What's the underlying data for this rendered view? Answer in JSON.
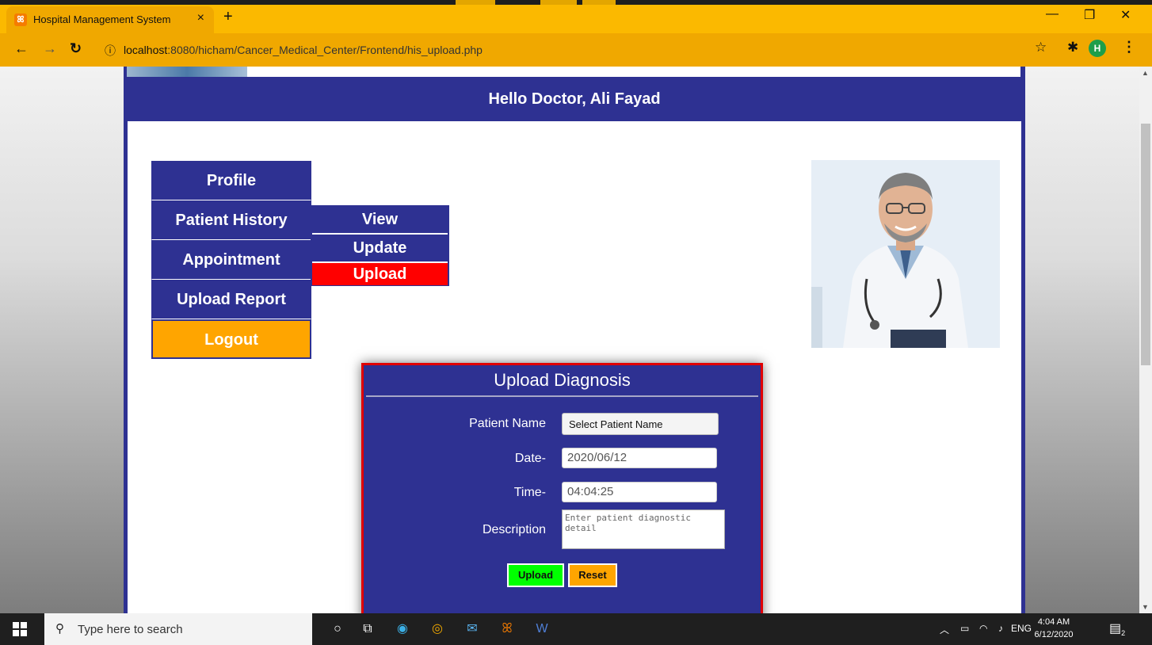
{
  "browser": {
    "tab_title": "Hospital Management System",
    "tab_close": "×",
    "new_tab": "+",
    "url_host": "localhost",
    "url_rest": ":8080/hicham/Cancer_Medical_Center/Frontend/his_upload.php",
    "profile_initial": "H",
    "window_controls": {
      "minimize": "—",
      "restore": "❐",
      "close": "✕"
    }
  },
  "page": {
    "greeting": "Hello Doctor, Ali Fayad",
    "menu": [
      {
        "label": "Profile"
      },
      {
        "label": "Patient History"
      },
      {
        "label": "Appointment"
      },
      {
        "label": "Upload Report"
      },
      {
        "label": "Logout"
      }
    ],
    "submenu": [
      {
        "label": "View"
      },
      {
        "label": "Update"
      },
      {
        "label": "Upload",
        "active": true
      }
    ],
    "form": {
      "title": "Upload Diagnosis",
      "patient_label": "Patient Name",
      "patient_value": "Select Patient Name",
      "date_label": "Date-",
      "date_value": "2020/06/12",
      "time_label": "Time-",
      "time_value": "04:04:25",
      "description_label": "Description",
      "description_placeholder": "Enter patient diagnostic detail",
      "upload_button": "Upload",
      "reset_button": "Reset"
    }
  },
  "taskbar": {
    "search_placeholder": "Type here to search",
    "lang": "ENG",
    "time": "4:04 AM",
    "date": "6/12/2020",
    "notification_count": "2"
  },
  "colors": {
    "navy": "#2e3192",
    "active_red": "#ff0000",
    "logout_orange": "#ffa500",
    "upload_green": "#00ff00",
    "chrome_yellow": "#fbb900"
  }
}
